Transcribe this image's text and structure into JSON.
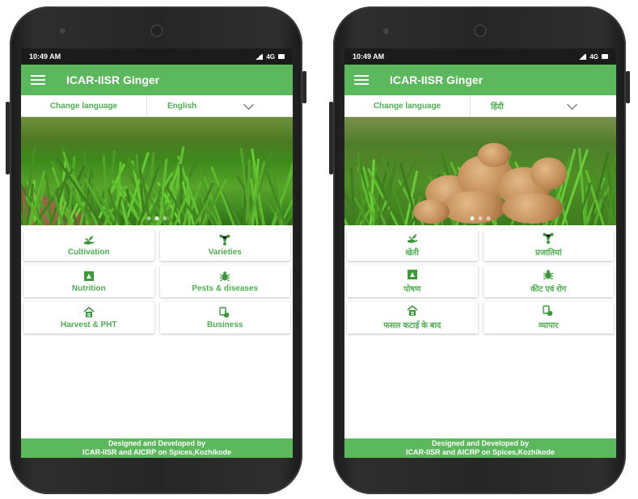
{
  "phones": [
    {
      "status_time": "10:49 AM",
      "network": "4G",
      "app_title": "ICAR-IISR Ginger",
      "change_language": "Change language",
      "selected_language": "English",
      "tiles": [
        {
          "label": "Cultivation",
          "icon": "hand-plant-icon"
        },
        {
          "label": "Varieties",
          "icon": "network-icon"
        },
        {
          "label": "Nutrition",
          "icon": "nutrition-icon"
        },
        {
          "label": "Pests & diseases",
          "icon": "bug-icon"
        },
        {
          "label": "Harvest & PHT",
          "icon": "storehouse-icon"
        },
        {
          "label": "Business",
          "icon": "business-icon"
        }
      ],
      "footer_line1": "Designed and Developed by",
      "footer_line2": "ICAR-IISR and AICRP on Spices,Kozhikode"
    },
    {
      "status_time": "10:49 AM",
      "network": "4G",
      "app_title": "ICAR-IISR Ginger",
      "change_language": "Change language",
      "selected_language": "हिंदी",
      "tiles": [
        {
          "label": "खेती",
          "icon": "hand-plant-icon"
        },
        {
          "label": "प्रजातियां",
          "icon": "network-icon"
        },
        {
          "label": "पोषण",
          "icon": "nutrition-icon"
        },
        {
          "label": "कीट एवं रोग",
          "icon": "bug-icon"
        },
        {
          "label": "फसल कटाई के बाद",
          "icon": "storehouse-icon"
        },
        {
          "label": "व्यापार",
          "icon": "business-icon"
        }
      ],
      "footer_line1": "Designed and Developed by",
      "footer_line2": "ICAR-IISR and AICRP on Spices,Kozhikode"
    }
  ],
  "colors": {
    "accent": "#5cb85c",
    "label_green": "#4caf50",
    "icon_green": "#3a9a3a",
    "status_bar": "#1b1b1b"
  }
}
